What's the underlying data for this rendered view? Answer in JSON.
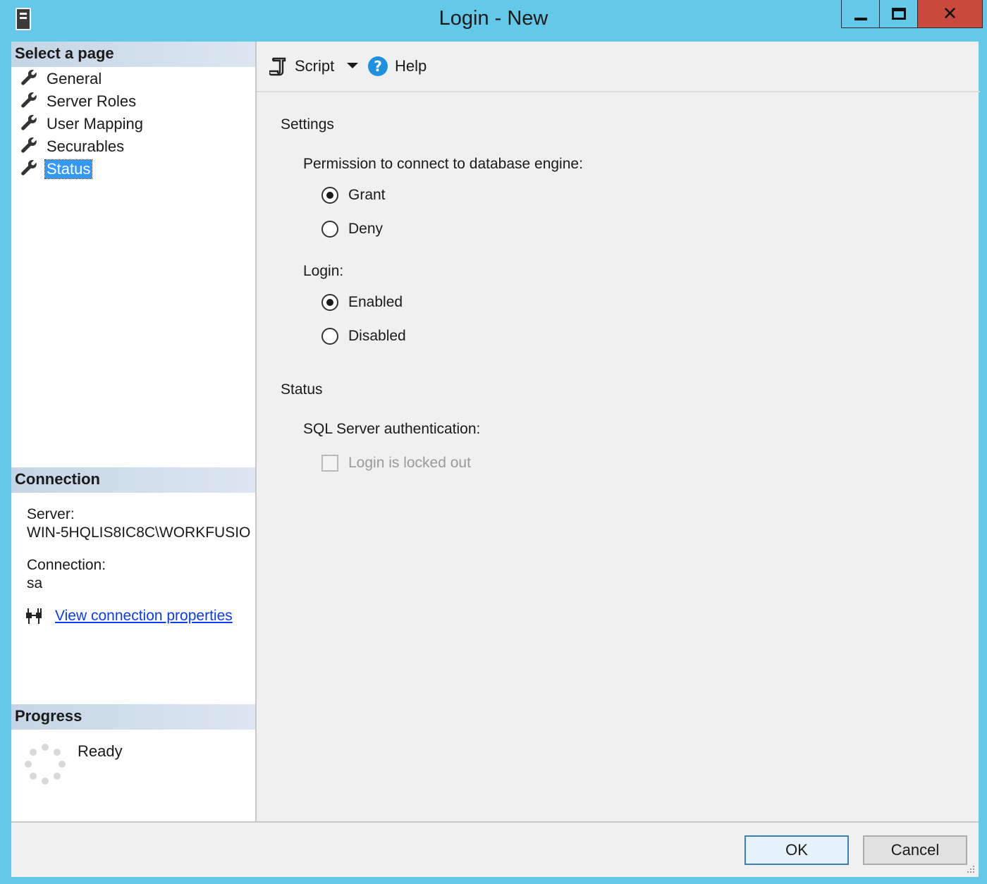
{
  "window": {
    "title": "Login - New",
    "controls": {
      "minimize": "minimize",
      "maximize": "maximize",
      "close": "✕"
    }
  },
  "sidebar": {
    "select_page_header": "Select a page",
    "pages": [
      {
        "label": "General",
        "icon": "wrench-icon"
      },
      {
        "label": "Server Roles",
        "icon": "wrench-icon"
      },
      {
        "label": "User Mapping",
        "icon": "wrench-icon"
      },
      {
        "label": "Securables",
        "icon": "wrench-icon"
      },
      {
        "label": "Status",
        "icon": "wrench-icon",
        "selected": true
      }
    ],
    "connection_header": "Connection",
    "server_label": "Server:",
    "server_value": "WIN-5HQLIS8IC8C\\WORKFUSIO",
    "connection_label": "Connection:",
    "connection_value": "sa",
    "view_connection_link": "View connection properties",
    "progress_header": "Progress",
    "progress_status": "Ready"
  },
  "toolbar": {
    "script_label": "Script",
    "help_label": "Help"
  },
  "settings": {
    "settings_heading": "Settings",
    "permission_label": "Permission to connect to database engine:",
    "grant_label": "Grant",
    "deny_label": "Deny",
    "permission_selected": "Grant",
    "login_label": "Login:",
    "enabled_label": "Enabled",
    "disabled_label": "Disabled",
    "login_selected": "Enabled",
    "status_heading": "Status",
    "sql_auth_label": "SQL Server authentication:",
    "locked_out_label": "Login is locked out",
    "locked_out_checked": false
  },
  "buttons": {
    "ok_label": "OK",
    "cancel_label": "Cancel"
  },
  "colors": {
    "title_bar": "#64c8e8",
    "close_button": "#c94a3c",
    "selection": "#3399ff",
    "link": "#0a3cf0"
  }
}
